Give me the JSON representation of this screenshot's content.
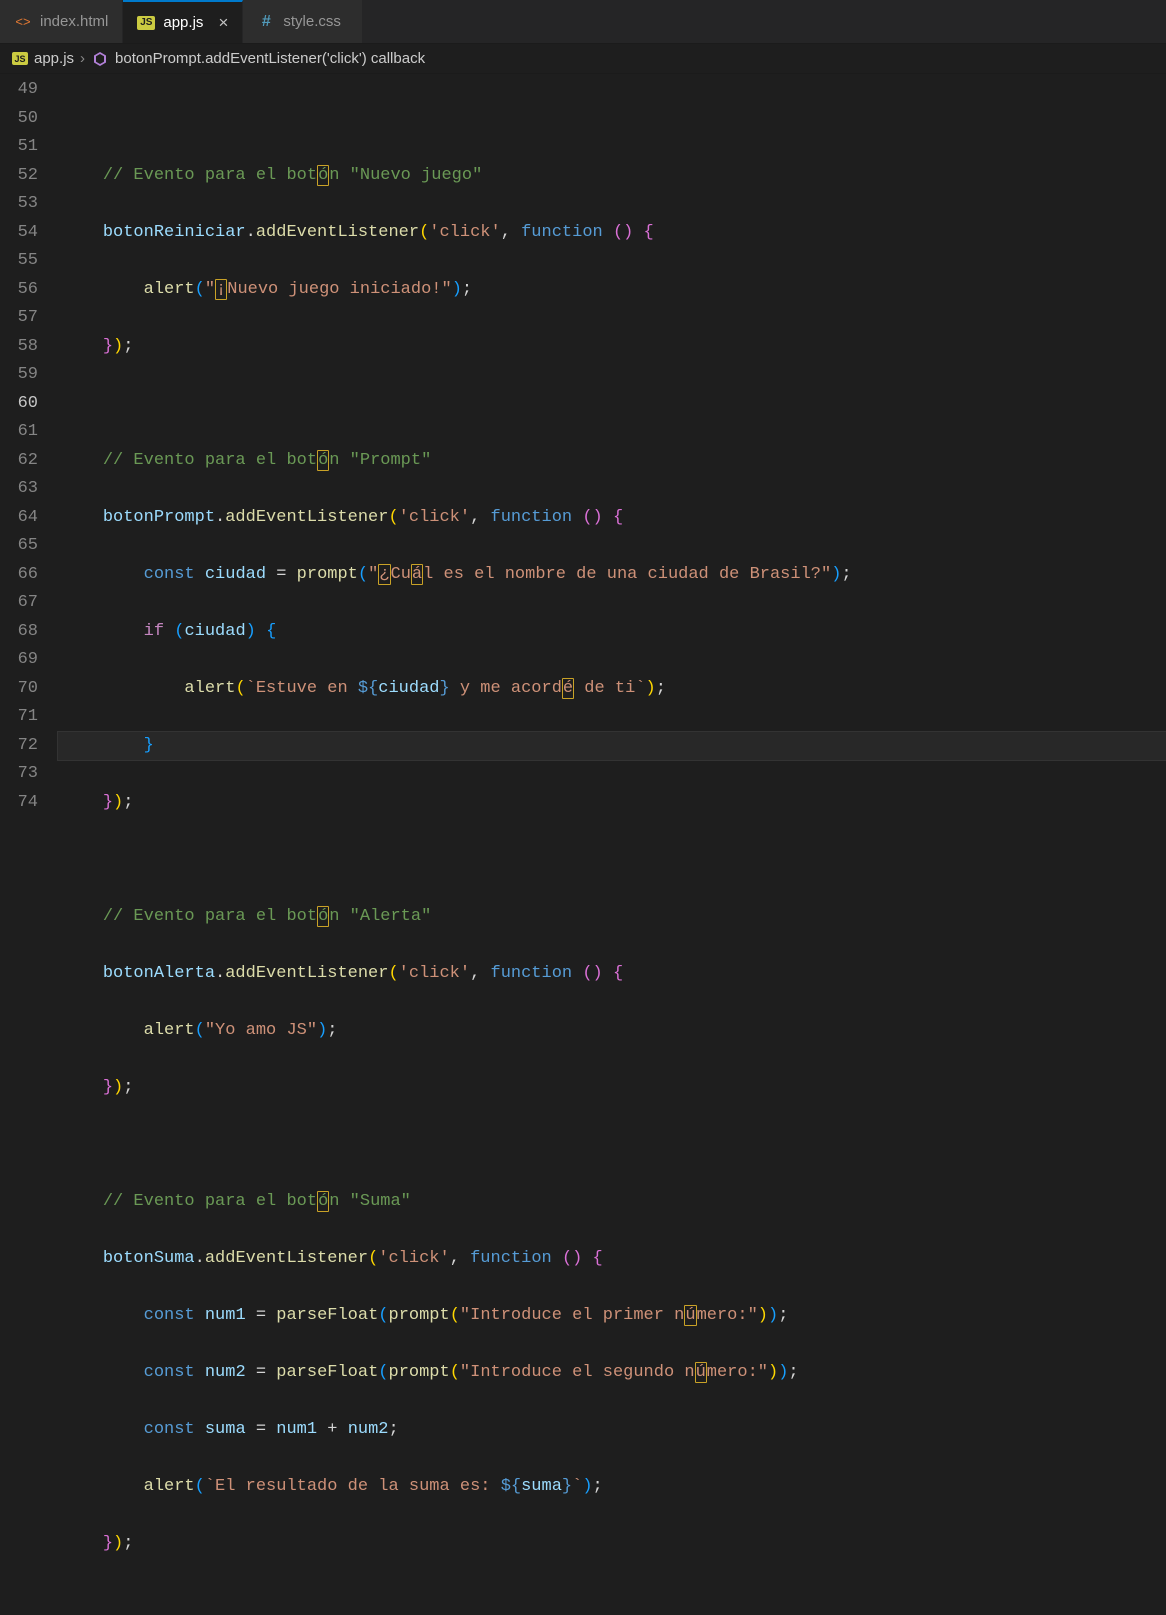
{
  "tabs": [
    {
      "icon": "html",
      "label": "index.html",
      "active": false,
      "close": false
    },
    {
      "icon": "js",
      "label": "app.js",
      "active": true,
      "close": true
    },
    {
      "icon": "css",
      "label": "style.css",
      "active": false,
      "close": false
    }
  ],
  "breadcrumb": {
    "file_icon": "js",
    "file": "app.js",
    "symbol_icon": "method",
    "symbol": "botonPrompt.addEventListener('click') callback"
  },
  "gutter": {
    "start": 49,
    "end": 74,
    "active": 60
  },
  "code": {
    "c49": "",
    "c50": "// Evento para el botón \"Nuevo juego\"",
    "c51_id1": "botonReiniciar",
    "c51_fn": "addEventListener",
    "c51_s": "'click'",
    "c51_kw": "function",
    "c52_fn": "alert",
    "c52_s": "\"¡Nuevo juego iniciado!\"",
    "c55": "// Evento para el botón \"Prompt\"",
    "c56_id1": "botonPrompt",
    "c56_fn": "addEventListener",
    "c56_s": "'click'",
    "c56_kw": "function",
    "c57_kw": "const",
    "c57_id": "ciudad",
    "c57_fn": "prompt",
    "c57_s": "\"¿Cuál es el nombre de una ciudad de Brasil?\"",
    "c58_kw": "if",
    "c58_id": "ciudad",
    "c59_fn": "alert",
    "c59_s1": "`Estuve en ",
    "c59_emb_o": "${",
    "c59_id": "ciudad",
    "c59_emb_c": "}",
    "c59_s2": " y me acordé de ti`",
    "c63": "// Evento para el botón \"Alerta\"",
    "c64_id1": "botonAlerta",
    "c64_fn": "addEventListener",
    "c64_s": "'click'",
    "c64_kw": "function",
    "c65_fn": "alert",
    "c65_s": "\"Yo amo JS\"",
    "c68": "// Evento para el botón \"Suma\"",
    "c69_id1": "botonSuma",
    "c69_fn": "addEventListener",
    "c69_s": "'click'",
    "c69_kw": "function",
    "c70_kw": "const",
    "c70_id": "num1",
    "c70_fn": "parseFloat",
    "c70_fn2": "prompt",
    "c70_s": "\"Introduce el primer número:\"",
    "c71_kw": "const",
    "c71_id": "num2",
    "c71_fn": "parseFloat",
    "c71_fn2": "prompt",
    "c71_s": "\"Introduce el segundo número:\"",
    "c72_kw": "const",
    "c72_id": "suma",
    "c72_id2": "num1",
    "c72_id3": "num2",
    "c73_fn": "alert",
    "c73_s1": "`El resultado de la suma es: ",
    "c73_emb_o": "${",
    "c73_id": "suma",
    "c73_emb_c": "}",
    "c73_s2": "`"
  }
}
